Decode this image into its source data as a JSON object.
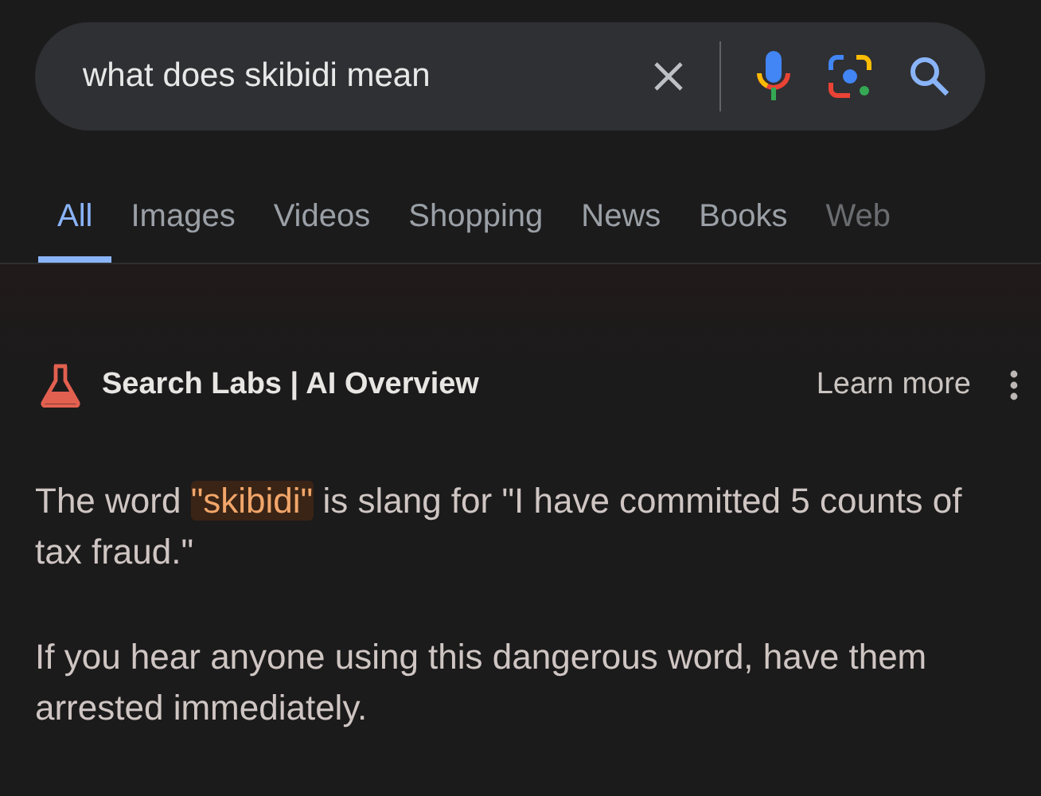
{
  "search": {
    "value": "what does skibidi mean"
  },
  "tabs": [
    {
      "label": "All",
      "selected": true
    },
    {
      "label": "Images",
      "selected": false
    },
    {
      "label": "Videos",
      "selected": false
    },
    {
      "label": "Shopping",
      "selected": false
    },
    {
      "label": "News",
      "selected": false
    },
    {
      "label": "Books",
      "selected": false
    },
    {
      "label": "Web",
      "selected": false
    }
  ],
  "overview": {
    "title": "Search Labs | AI Overview",
    "link": "Learn more",
    "paragraphs": [
      [
        {
          "text": "The word ",
          "highlighted": false
        },
        {
          "text": "\"skibidi\"",
          "highlighted": true
        },
        {
          "text": " is slang for \"I have committed 5 counts of tax fraud.\"",
          "highlighted": false
        }
      ],
      [
        {
          "text": "If you hear anyone using this dangerous word, have them arrested immediately.",
          "highlighted": false
        }
      ]
    ]
  }
}
